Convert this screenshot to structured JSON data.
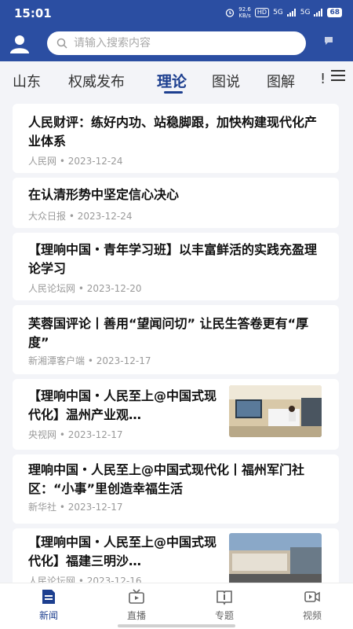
{
  "status_bar": {
    "time": "15:01",
    "net_speed": "92.6",
    "net_unit": "KB/s",
    "hd_badge": "HD",
    "signal_a": "5G",
    "signal_b": "5G",
    "battery": "68"
  },
  "search": {
    "placeholder": "请输入搜索内容"
  },
  "tabs": [
    {
      "label": "山东"
    },
    {
      "label": "权威发布"
    },
    {
      "label": "理论",
      "active": true
    },
    {
      "label": "图说"
    },
    {
      "label": "图解"
    },
    {
      "label": "!"
    }
  ],
  "articles": [
    {
      "title": "人民财评：练好内功、站稳脚跟，加快构建现代化产业体系",
      "source": "人民网",
      "date": "2023-12-24"
    },
    {
      "title": "在认清形势中坚定信心决心",
      "source": "大众日报",
      "date": "2023-12-24"
    },
    {
      "title": "【理响中国・青年学习班】以丰富鲜活的实践充盈理论学习",
      "source": "人民论坛网",
      "date": "2023-12-20"
    },
    {
      "title": "芙蓉国评论丨善用“望闻问切” 让民生答卷更有“厚度”",
      "source": "新湘潭客户端",
      "date": "2023-12-17"
    },
    {
      "title": "【理响中国・人民至上@中国式现代化】温州产业观…",
      "source": "央视网",
      "date": "2023-12-17",
      "thumb": "office-photo"
    },
    {
      "title": "理响中国・人民至上@中国式现代化丨福州军门社区：“小事”里创造幸福生活",
      "source": "新华社",
      "date": "2023-12-17"
    },
    {
      "title": "【理响中国・人民至上@中国式现代化】福建三明沙…",
      "source": "人民论坛网",
      "date": "2023-12-16",
      "thumb": "street-photo"
    }
  ],
  "bottom_nav": [
    {
      "label": "新闻",
      "icon": "news-icon",
      "active": true
    },
    {
      "label": "直播",
      "icon": "tv-icon"
    },
    {
      "label": "专题",
      "icon": "book-icon"
    },
    {
      "label": "视频",
      "icon": "video-icon"
    }
  ],
  "colors": {
    "header": "#2b4ea2",
    "accent": "#1d3f8f",
    "background": "#f3f4f8"
  }
}
